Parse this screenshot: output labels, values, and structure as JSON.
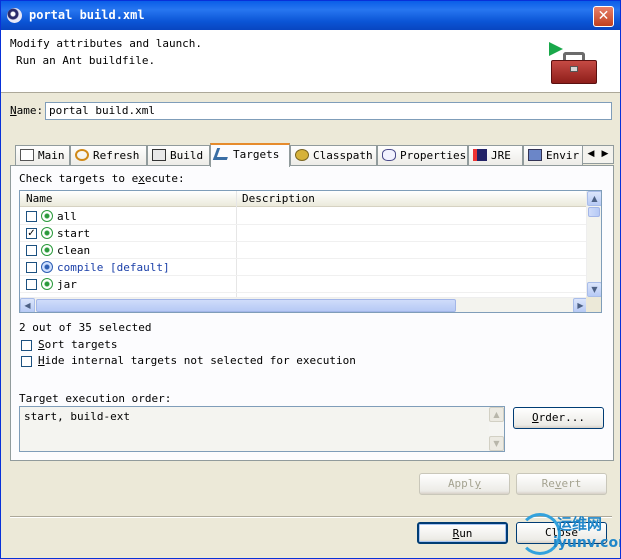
{
  "window": {
    "title": "portal build.xml",
    "close_glyph": "✕"
  },
  "header": {
    "line1": "Modify attributes and launch.",
    "line2": "Run an Ant buildfile."
  },
  "name_field": {
    "label": "Name:",
    "value": "portal build.xml"
  },
  "tabs": [
    {
      "label": "Main",
      "icon": "main-tab-icon"
    },
    {
      "label": "Refresh",
      "icon": "refresh-icon"
    },
    {
      "label": "Build",
      "icon": "build-icon"
    },
    {
      "label": "Targets",
      "icon": "targets-icon",
      "active": true
    },
    {
      "label": "Classpath",
      "icon": "classpath-icon"
    },
    {
      "label": "Properties",
      "icon": "properties-icon"
    },
    {
      "label": "JRE",
      "icon": "jre-icon"
    },
    {
      "label": "Envir",
      "icon": "environment-icon"
    }
  ],
  "targets": {
    "caption": "Check targets to execute:",
    "columns": [
      "Name",
      "Description"
    ],
    "rows": [
      {
        "name": "all",
        "checked": false,
        "default": false
      },
      {
        "name": "start",
        "checked": true,
        "default": false
      },
      {
        "name": "clean",
        "checked": false,
        "default": false
      },
      {
        "name": "compile [default]",
        "checked": false,
        "default": true
      },
      {
        "name": "jar",
        "checked": false,
        "default": false
      }
    ],
    "selection_summary": "2 out of 35 selected"
  },
  "options": {
    "sort_label": "Sort targets",
    "hide_label": "Hide internal targets not selected for execution"
  },
  "execution_order": {
    "label": "Target execution order:",
    "value": "start, build-ext",
    "order_button": "Order..."
  },
  "buttons": {
    "apply": "Apply",
    "revert": "Revert",
    "run": "Run",
    "close": "Close"
  },
  "watermark": {
    "line1": "运维网",
    "line2": "iyunv.com"
  }
}
